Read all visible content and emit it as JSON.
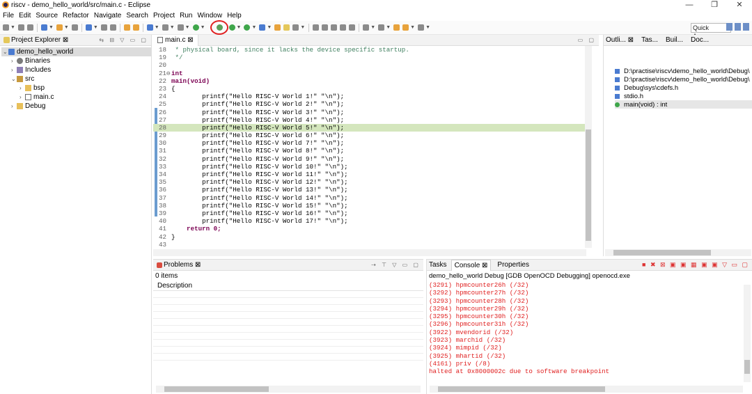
{
  "window": {
    "title": "riscv - demo_hello_world/src/main.c - Eclipse",
    "controls": [
      "—",
      "❐",
      "✕"
    ]
  },
  "menu": [
    "File",
    "Edit",
    "Source",
    "Refactor",
    "Navigate",
    "Search",
    "Project",
    "Run",
    "Window",
    "Help"
  ],
  "toolbar": {
    "quick_access": "Quick Access"
  },
  "project_explorer": {
    "title": "Project Explorer ⊠",
    "items": [
      {
        "arrow": "⌄",
        "label": "demo_hello_world",
        "icon": "project-icon"
      },
      {
        "arrow": "›",
        "label": "Binaries",
        "icon": "binaries-icon"
      },
      {
        "arrow": "›",
        "label": "Includes",
        "icon": "includes-icon"
      },
      {
        "arrow": "⌄",
        "label": "src",
        "icon": "source-folder-icon"
      },
      {
        "arrow": "›",
        "label": "bsp",
        "icon": "folder-icon"
      },
      {
        "arrow": "›",
        "label": "main.c",
        "icon": "c-file-icon"
      },
      {
        "arrow": "›",
        "label": "Debug",
        "icon": "folder-icon"
      }
    ]
  },
  "editor": {
    "tab": "main.c ⊠",
    "lines": [
      {
        "n": "18",
        "t": " * physical board, since it lacks the device specific startup."
      },
      {
        "n": "19",
        "t": " */"
      },
      {
        "n": "20",
        "t": ""
      },
      {
        "n": "21⊖",
        "t": "int"
      },
      {
        "n": "22",
        "t": "main(void)"
      },
      {
        "n": "23",
        "t": "{"
      },
      {
        "n": "24",
        "t": "        printf(\"Hello RISC-V World 1!\" \"\\n\");"
      },
      {
        "n": "25",
        "t": "        printf(\"Hello RISC-V World 2!\" \"\\n\");"
      },
      {
        "n": "26",
        "t": "        printf(\"Hello RISC-V World 3!\" \"\\n\");"
      },
      {
        "n": "27",
        "t": "        printf(\"Hello RISC-V World 4!\" \"\\n\");"
      },
      {
        "n": "28",
        "t": "        printf(\"Hello RISC-V World 5!\" \"\\n\");"
      },
      {
        "n": "29",
        "t": "        printf(\"Hello RISC-V World 6!\" \"\\n\");"
      },
      {
        "n": "30",
        "t": "        printf(\"Hello RISC-V World 7!\" \"\\n\");"
      },
      {
        "n": "31",
        "t": "        printf(\"Hello RISC-V World 8!\" \"\\n\");"
      },
      {
        "n": "32",
        "t": "        printf(\"Hello RISC-V World 9!\" \"\\n\");"
      },
      {
        "n": "33",
        "t": "        printf(\"Hello RISC-V World 10!\" \"\\n\");"
      },
      {
        "n": "34",
        "t": "        printf(\"Hello RISC-V World 11!\" \"\\n\");"
      },
      {
        "n": "35",
        "t": "        printf(\"Hello RISC-V World 12!\" \"\\n\");"
      },
      {
        "n": "36",
        "t": "        printf(\"Hello RISC-V World 13!\" \"\\n\");"
      },
      {
        "n": "37",
        "t": "        printf(\"Hello RISC-V World 14!\" \"\\n\");"
      },
      {
        "n": "38",
        "t": "        printf(\"Hello RISC-V World 15!\" \"\\n\");"
      },
      {
        "n": "39",
        "t": "        printf(\"Hello RISC-V World 16!\" \"\\n\");"
      },
      {
        "n": "40",
        "t": "        printf(\"Hello RISC-V World 17!\" \"\\n\");"
      },
      {
        "n": "41",
        "t": "    return 0;"
      },
      {
        "n": "42",
        "t": "}"
      },
      {
        "n": "43",
        "t": ""
      }
    ],
    "active_line": "28"
  },
  "outline": {
    "tabs": [
      "Outli... ⊠",
      "Tas...",
      "Buil...",
      "Doc..."
    ],
    "items": [
      {
        "label": "D:\\practise\\riscv\\demo_hello_world\\Debug\\",
        "icon": "include-file-icon"
      },
      {
        "label": "D:\\practise\\riscv\\demo_hello_world\\Debug\\",
        "icon": "include-file-icon"
      },
      {
        "label": "Debug\\sys\\cdefs.h",
        "icon": "include-file-icon"
      },
      {
        "label": "stdio.h",
        "icon": "include-file-icon"
      },
      {
        "label": "main(void) : int",
        "icon": "function-icon"
      }
    ]
  },
  "problems": {
    "title": "Problems ⊠",
    "count": "0 items",
    "column": "Description"
  },
  "console": {
    "tabs": [
      "Tasks",
      "Console ⊠",
      "Properties"
    ],
    "launch": "demo_hello_world Debug [GDB OpenOCD Debugging] openocd.exe",
    "lines": [
      "(3291) hpmcounter26h (/32)",
      "(3292) hpmcounter27h (/32)",
      "(3293) hpmcounter28h (/32)",
      "(3294) hpmcounter29h (/32)",
      "(3295) hpmcounter30h (/32)",
      "(3296) hpmcounter31h (/32)",
      "(3922) mvendorid (/32)",
      "(3923) marchid (/32)",
      "(3924) mimpid (/32)",
      "(3925) mhartid (/32)",
      "(4161) priv (/8)",
      "halted at 0x8000002c due to software breakpoint"
    ]
  }
}
